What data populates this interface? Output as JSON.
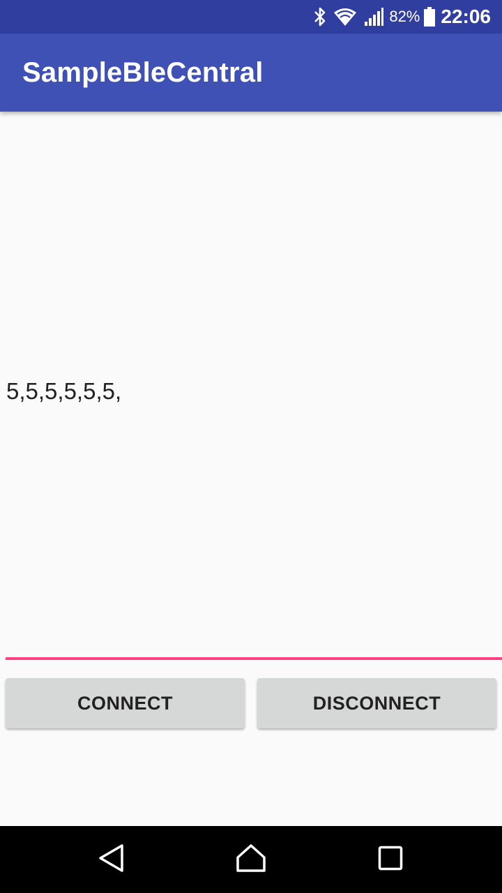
{
  "status_bar": {
    "battery_percent": "82%",
    "time": "22:06",
    "icons": [
      "bluetooth-icon",
      "wifi-icon",
      "signal-icon",
      "battery-icon"
    ],
    "background": "#303f9f"
  },
  "app_bar": {
    "title": "SampleBleCentral",
    "background": "#3f51b5"
  },
  "main": {
    "received_text": "5,5,5,5,5,5,",
    "edit_field": {
      "value": "",
      "underline_color": "#ff4081"
    },
    "buttons": {
      "connect_label": "CONNECT",
      "disconnect_label": "DISCONNECT"
    }
  },
  "nav_bar": {
    "icons": [
      "back-icon",
      "home-icon",
      "recents-icon"
    ]
  }
}
